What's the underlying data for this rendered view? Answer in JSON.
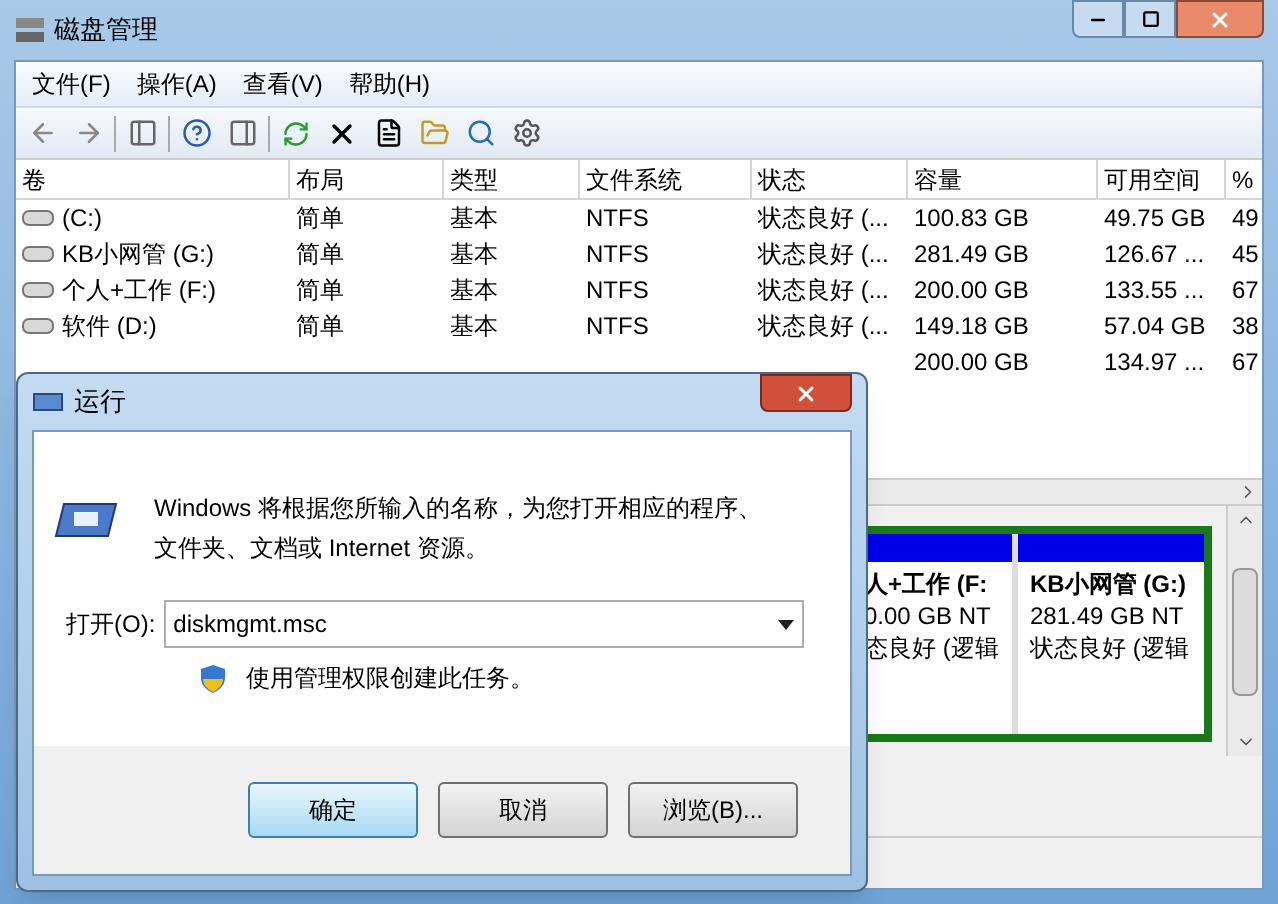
{
  "window": {
    "title": "磁盘管理"
  },
  "menu": [
    "文件(F)",
    "操作(A)",
    "查看(V)",
    "帮助(H)"
  ],
  "volume_table": {
    "columns": [
      "卷",
      "布局",
      "类型",
      "文件系统",
      "状态",
      "容量",
      "可用空间",
      "%"
    ],
    "rows": [
      {
        "volume": "(C:)",
        "layout": "简单",
        "type": "基本",
        "fs": "NTFS",
        "status": "状态良好 (...",
        "capacity": "100.83 GB",
        "free": "49.75 GB",
        "percent": "49"
      },
      {
        "volume": "KB小网管 (G:)",
        "layout": "简单",
        "type": "基本",
        "fs": "NTFS",
        "status": "状态良好 (...",
        "capacity": "281.49 GB",
        "free": "126.67 ...",
        "percent": "45"
      },
      {
        "volume": "个人+工作 (F:)",
        "layout": "简单",
        "type": "基本",
        "fs": "NTFS",
        "status": "状态良好 (...",
        "capacity": "200.00 GB",
        "free": "133.55 ...",
        "percent": "67"
      },
      {
        "volume": "软件 (D:)",
        "layout": "简单",
        "type": "基本",
        "fs": "NTFS",
        "status": "状态良好 (...",
        "capacity": "149.18 GB",
        "free": "57.04 GB",
        "percent": "38"
      },
      {
        "capacity": "200.00 GB",
        "free": "134.97 ...",
        "percent": "67"
      }
    ]
  },
  "disk_map": {
    "partitions": [
      {
        "name": "人+工作 (F:",
        "size": "0.00 GB NT",
        "status": "态良好 (逻辑"
      },
      {
        "name": "KB小网管 (G:)",
        "size": "281.49 GB NT",
        "status": "状态良好 (逻辑"
      }
    ]
  },
  "run_dialog": {
    "title": "运行",
    "description_lines": [
      "Windows 将根据您所输入的名称，为您打开相应的程序、",
      "文件夹、文档或 Internet 资源。"
    ],
    "open_label": "打开(O):",
    "command": "diskmgmt.msc",
    "admin_note": "使用管理权限创建此任务。",
    "buttons": [
      {
        "label": "确定",
        "selected": true
      },
      {
        "label": "取消",
        "selected": false
      },
      {
        "label": "浏览(B)...",
        "selected": false
      }
    ]
  }
}
